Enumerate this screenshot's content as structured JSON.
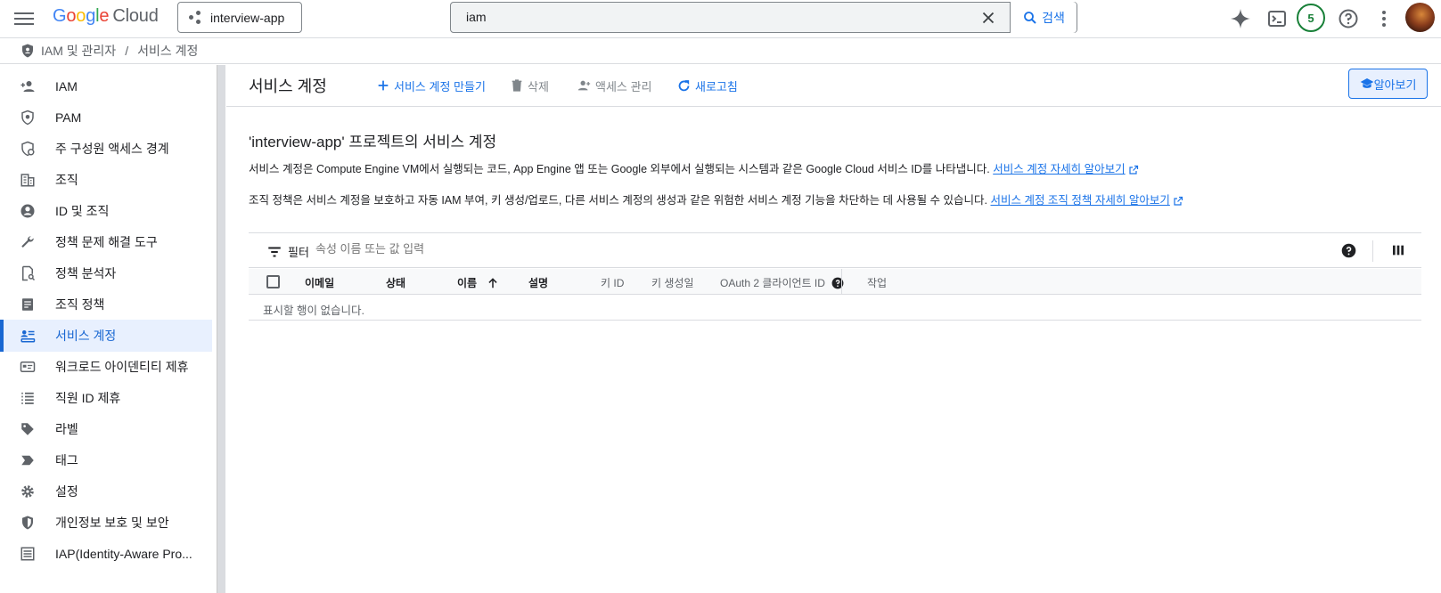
{
  "header": {
    "logo": {
      "google": "Google",
      "cloud": "Cloud"
    },
    "project": "interview-app",
    "search": {
      "value": "iam",
      "button_label": "검색"
    },
    "notifications_count": "5"
  },
  "breadcrumb": {
    "section": "IAM 및 관리자",
    "separator": "/",
    "page": "서비스 계정"
  },
  "sidebar": {
    "items": [
      {
        "label": "IAM",
        "icon": "person-add-icon"
      },
      {
        "label": "PAM",
        "icon": "shield-icon"
      },
      {
        "label": "주 구성원 액세스 경계",
        "icon": "boundary-icon"
      },
      {
        "label": "조직",
        "icon": "building-icon"
      },
      {
        "label": "ID 및 조직",
        "icon": "account-circle-icon"
      },
      {
        "label": "정책 문제 해결 도구",
        "icon": "wrench-icon"
      },
      {
        "label": "정책 분석자",
        "icon": "policy-analyzer-icon"
      },
      {
        "label": "조직 정책",
        "icon": "document-icon"
      },
      {
        "label": "서비스 계정",
        "icon": "service-account-icon",
        "active": true
      },
      {
        "label": "워크로드 아이덴티티 제휴",
        "icon": "id-card-icon"
      },
      {
        "label": "직원 ID 제휴",
        "icon": "list-icon"
      },
      {
        "label": "라벨",
        "icon": "label-icon"
      },
      {
        "label": "태그",
        "icon": "tag-icon"
      },
      {
        "label": "설정",
        "icon": "gear-icon"
      },
      {
        "label": "개인정보 보호 및 보안",
        "icon": "security-shield-icon"
      },
      {
        "label": "IAP(Identity-Aware Pro...",
        "icon": "iap-icon"
      }
    ]
  },
  "main": {
    "title": "서비스 계정",
    "actions": {
      "create": "서비스 계정 만들기",
      "delete": "삭제",
      "manage_access": "액세스 관리",
      "refresh": "새로고침",
      "learn": "알아보기"
    },
    "section_title": "'interview-app' 프로젝트의 서비스 계정",
    "desc1": "서비스 계정은 Compute Engine VM에서 실행되는 코드, App Engine 앱 또는 Google 외부에서 실행되는 시스템과 같은 Google Cloud 서비스 ID를 나타냅니다.",
    "desc1_link": "서비스 계정 자세히 알아보기",
    "desc2": "조직 정책은 서비스 계정을 보호하고 자동 IAM 부여, 키 생성/업로드, 다른 서비스 계정의 생성과 같은 위험한 서비스 계정 기능을 차단하는 데 사용될 수 있습니다.",
    "desc2_link": "서비스 계정 조직 정책 자세히 알아보기",
    "filter": {
      "label": "필터",
      "placeholder": "속성 이름 또는 값 입력"
    },
    "table": {
      "columns": [
        "이메일",
        "상태",
        "이름",
        "설명",
        "키 ID",
        "키 생성일",
        "OAuth 2 클라이언트 ID",
        "작업"
      ],
      "empty_message": "표시할 행이 없습니다."
    }
  },
  "colors": {
    "accent": "#1a73e8",
    "active_bg": "#e8f0fe",
    "border": "#dadce0"
  }
}
